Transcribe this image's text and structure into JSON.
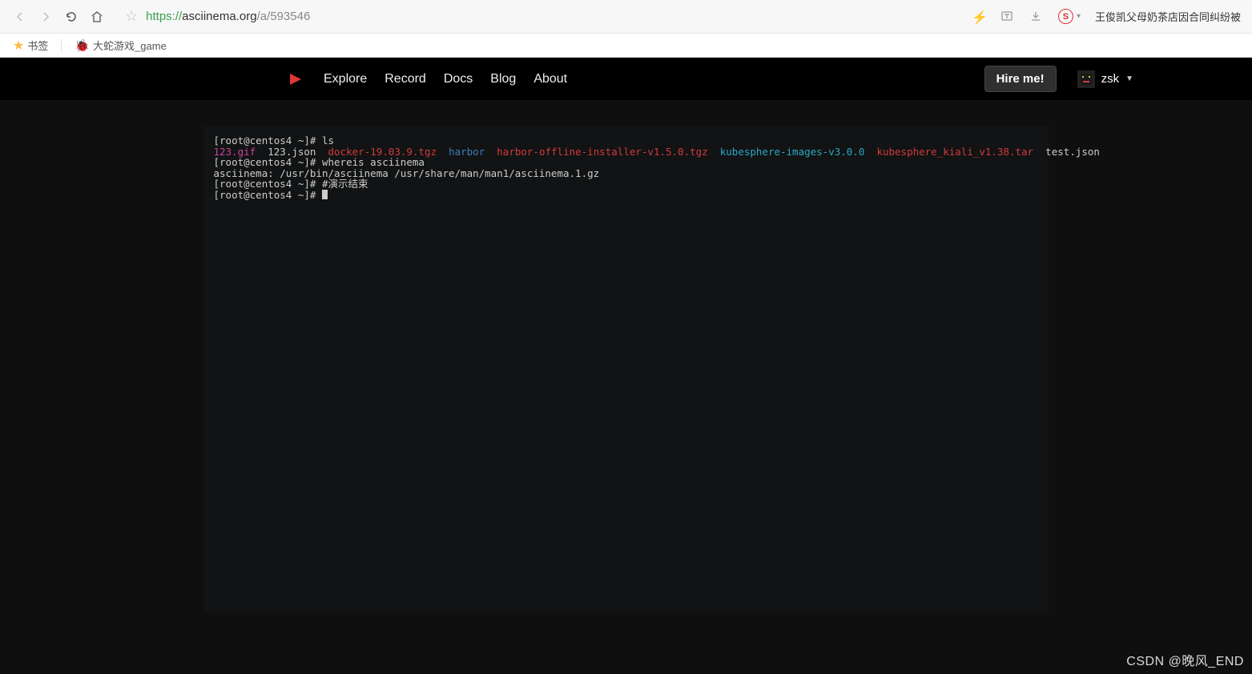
{
  "browser": {
    "url_scheme": "https://",
    "url_host": "asciinema.org",
    "url_path": "/a/593546",
    "right_text": "王俊凯父母奶茶店因合同纠纷被"
  },
  "bookmarks": {
    "b1": "书签",
    "b2": "大蛇游戏_game"
  },
  "nav": {
    "explore": "Explore",
    "record": "Record",
    "docs": "Docs",
    "blog": "Blog",
    "about": "About",
    "hire": "Hire me!",
    "user": "zsk"
  },
  "terminal": {
    "prompt": "[root@centos4 ~]# ",
    "l1_cmd": "ls",
    "ls": {
      "f1": "123.gif",
      "f2": "123.json",
      "f3": "docker-19.03.9.tgz",
      "f4": "harbor",
      "f5": "harbor-offline-installer-v1.5.0.tgz",
      "f6": "kubesphere-images-v3.0.0",
      "f7": "kubesphere_kiali_v1.38.tar",
      "f8": "test.json"
    },
    "l3_cmd": "whereis asciinema",
    "l4_out": "asciinema: /usr/bin/asciinema /usr/share/man/man1/asciinema.1.gz",
    "l5_cmd": "#演示结束"
  },
  "watermark": "CSDN @晚风_END"
}
